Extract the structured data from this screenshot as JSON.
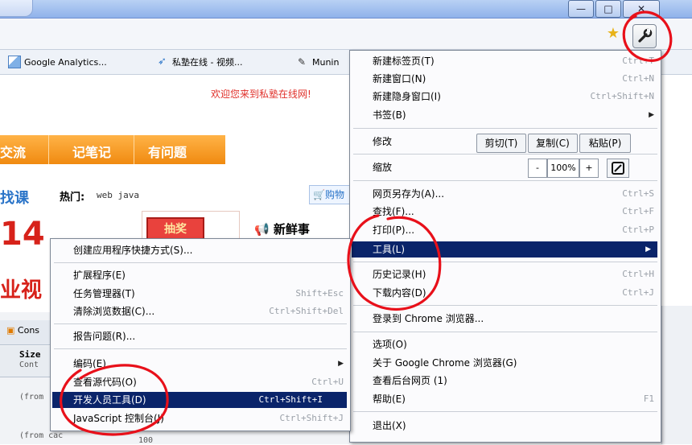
{
  "window": {
    "minimize_glyph": "—",
    "maximize_glyph": "□",
    "close_glyph": "✕"
  },
  "toolbar": {
    "star_icon": "star-icon",
    "wrench_icon": "wrench-icon"
  },
  "bookmarks": [
    {
      "label": "Google Analytics...",
      "icon": "analytics-icon"
    },
    {
      "label": "私塾在线 - 视频...",
      "icon": "bird-icon"
    },
    {
      "label": "Munin",
      "icon": "munin-icon"
    }
  ],
  "page": {
    "welcome": "欢迎您来到私塾在线网!",
    "nav": [
      "交流",
      "记笔记",
      "有问题"
    ],
    "search_label": "找课",
    "hot_label": "热门:",
    "hot_words": "web  java",
    "cart": "购物",
    "big_number": "14",
    "big_text": "业视",
    "promo": "抽奖",
    "news": "新鲜事",
    "con_label": "Cons",
    "size_label": "Size",
    "cont_label": "Cont",
    "from_1": "(from",
    "from_2": "(from cac",
    "from_2_tail": "100"
  },
  "main_menu": {
    "new_tab": {
      "label": "新建标签页(T)",
      "shortcut": "Ctrl+T"
    },
    "new_window": {
      "label": "新建窗口(N)",
      "shortcut": "Ctrl+N"
    },
    "new_incognito": {
      "label": "新建隐身窗口(I)",
      "shortcut": "Ctrl+Shift+N"
    },
    "bookmarks": {
      "label": "书签(B)"
    },
    "edit": {
      "label": "修改",
      "cut": "剪切(T)",
      "copy": "复制(C)",
      "paste": "粘贴(P)"
    },
    "zoom": {
      "label": "缩放",
      "minus": "-",
      "value": "100%",
      "plus": "+"
    },
    "save_as": {
      "label": "网页另存为(A)...",
      "shortcut": "Ctrl+S"
    },
    "find": {
      "label": "查找(F)...",
      "shortcut": "Ctrl+F"
    },
    "print": {
      "label": "打印(P)...",
      "shortcut": "Ctrl+P"
    },
    "tools": {
      "label": "工具(L)"
    },
    "history": {
      "label": "历史记录(H)",
      "shortcut": "Ctrl+H"
    },
    "downloads": {
      "label": "下载内容(D)",
      "shortcut": "Ctrl+J"
    },
    "sign_in": {
      "label": "登录到 Chrome 浏览器..."
    },
    "options": {
      "label": "选项(O)"
    },
    "about": {
      "label": "关于 Google Chrome 浏览器(G)"
    },
    "background": {
      "label": "查看后台网页 (1)"
    },
    "help": {
      "label": "帮助(E)",
      "shortcut": "F1"
    },
    "exit": {
      "label": "退出(X)"
    }
  },
  "tools_menu": {
    "create_shortcut": {
      "label": "创建应用程序快捷方式(S)..."
    },
    "extensions": {
      "label": "扩展程序(E)"
    },
    "task_manager": {
      "label": "任务管理器(T)",
      "shortcut": "Shift+Esc"
    },
    "clear_data": {
      "label": "清除浏览数据(C)...",
      "shortcut": "Ctrl+Shift+Del"
    },
    "report_issue": {
      "label": "报告问题(R)..."
    },
    "encoding": {
      "label": "编码(E)"
    },
    "view_source": {
      "label": "查看源代码(O)",
      "shortcut": "Ctrl+U"
    },
    "dev_tools": {
      "label": "开发人员工具(D)",
      "shortcut": "Ctrl+Shift+I"
    },
    "js_console": {
      "label": "JavaScript 控制台(J)",
      "shortcut": "Ctrl+Shift+J"
    }
  },
  "colors": {
    "highlight": "#0a246a",
    "annotation": "#e8101a",
    "accent_orange": "#f08a10"
  }
}
